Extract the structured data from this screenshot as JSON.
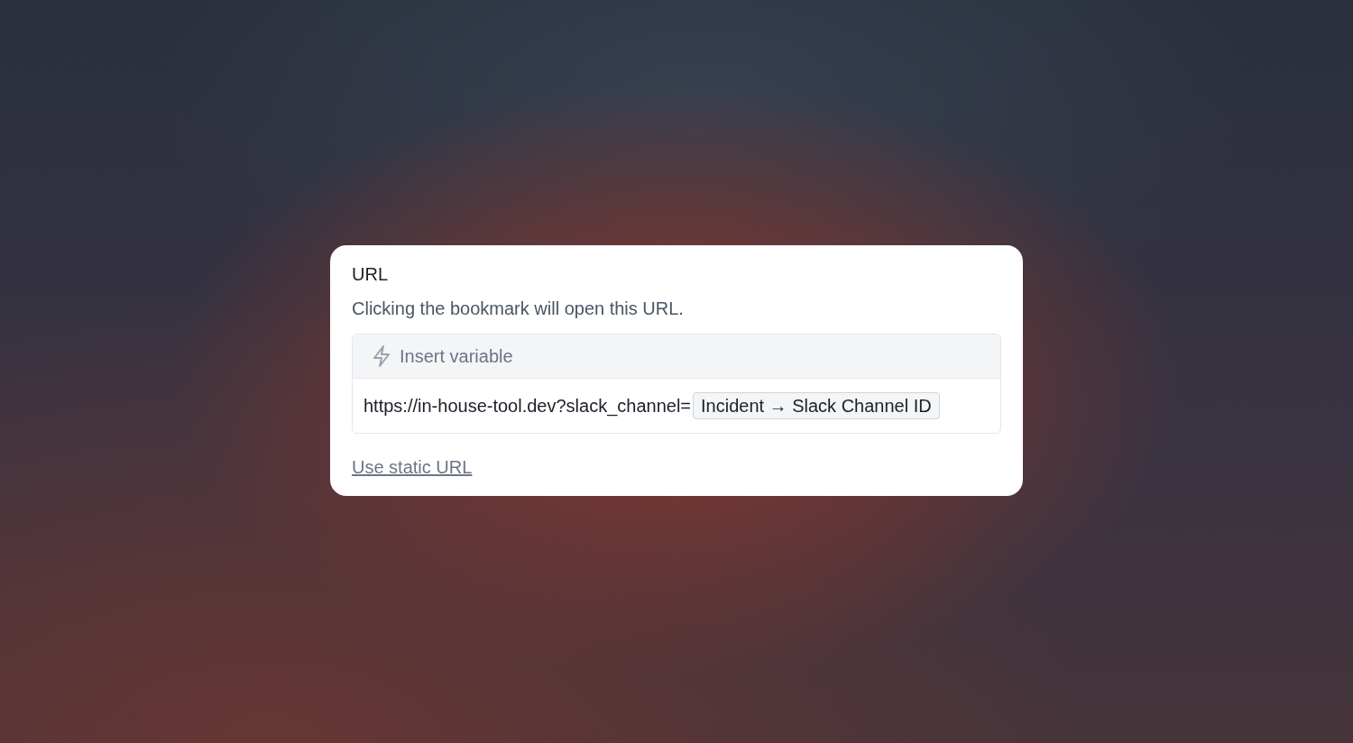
{
  "field": {
    "label": "URL",
    "description": "Clicking the bookmark will open this URL."
  },
  "editor": {
    "toolbar": {
      "button": "Insert variable"
    },
    "content": [
      {
        "kind": "text",
        "text": "https://in-house-tool.dev?slack_channel="
      },
      {
        "kind": "variable",
        "text": "Incident → Slack Channel ID"
      }
    ]
  },
  "link": "Use static URL"
}
